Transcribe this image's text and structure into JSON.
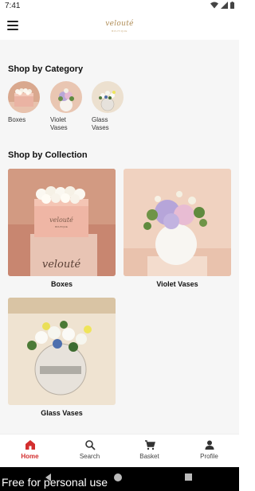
{
  "status": {
    "time": "7:41"
  },
  "header": {
    "logo_text": "velouté",
    "logo_sub": "BOUTIQUE"
  },
  "sections": {
    "category_title": "Shop by Category",
    "collection_title": "Shop by Collection"
  },
  "categories": [
    {
      "label": "Boxes"
    },
    {
      "label": "Violet Vases"
    },
    {
      "label": "Glass Vases"
    }
  ],
  "collections": [
    {
      "label": "Boxes",
      "brand_text": "velouté",
      "box_text": "velouté",
      "box_sub": "BOUTIQUE"
    },
    {
      "label": "Violet Vases"
    },
    {
      "label": "Glass Vases"
    }
  ],
  "bottom_nav": [
    {
      "label": "Home",
      "icon": "home-icon",
      "active": true
    },
    {
      "label": "Search",
      "icon": "search-icon",
      "active": false
    },
    {
      "label": "Basket",
      "icon": "cart-icon",
      "active": false
    },
    {
      "label": "Profile",
      "icon": "person-icon",
      "active": false
    }
  ],
  "watermark": "Free for personal use",
  "colors": {
    "accent": "#d32f2f",
    "brand_gold": "#b08d57",
    "background": "#f6f6f6"
  }
}
